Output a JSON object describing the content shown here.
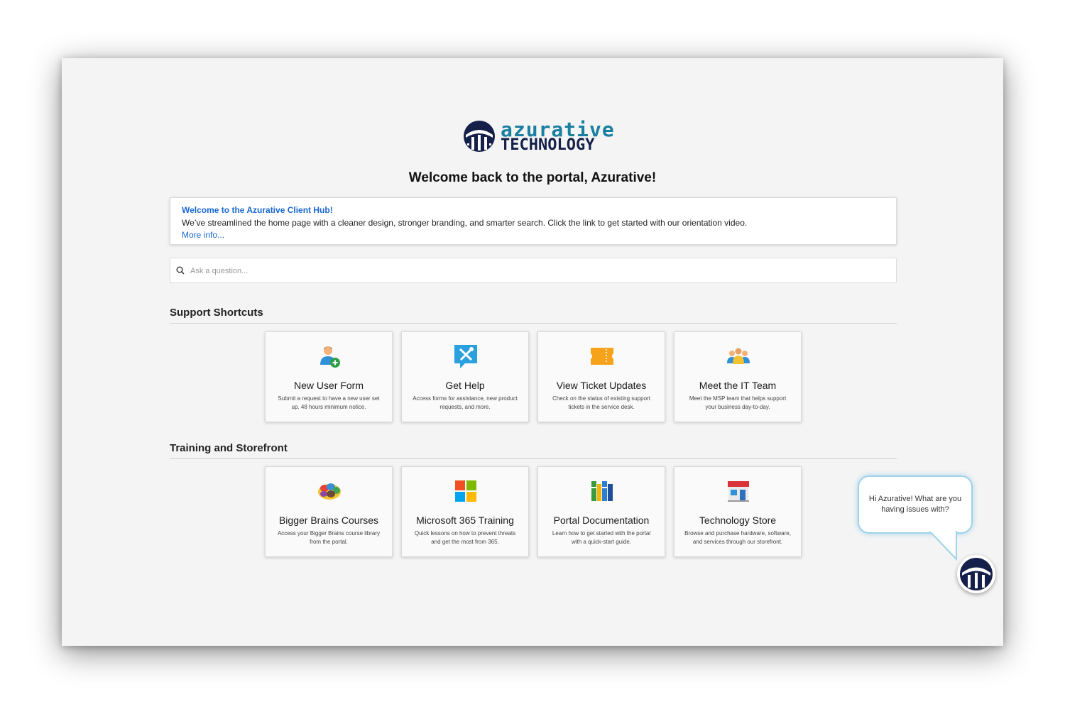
{
  "brand": {
    "line1": "azurative",
    "line2": "TECHNOLOGY"
  },
  "welcome_title": "Welcome back to the portal, Azurative!",
  "banner": {
    "title": "Welcome to the Azurative Client Hub!",
    "body": "We’ve streamlined the home page with a cleaner design, stronger branding, and smarter search. Click the link to get started with our orientation video.",
    "link": "More info..."
  },
  "search": {
    "placeholder": "Ask a question..."
  },
  "sections": [
    {
      "title": "Support Shortcuts",
      "tiles": [
        {
          "icon": "add-user-icon",
          "title": "New User Form",
          "desc": "Submit a request to have a new user set up. 48 hours minimum notice."
        },
        {
          "icon": "help-tools-icon",
          "title": "Get Help",
          "desc": "Access forms for assistance, new product requests, and more."
        },
        {
          "icon": "ticket-icon",
          "title": "View Ticket Updates",
          "desc": "Check on the status of existing support tickets in the service desk."
        },
        {
          "icon": "team-icon",
          "title": "Meet the IT Team",
          "desc": "Meet the MSP team that helps support your business day-to-day."
        }
      ]
    },
    {
      "title": "Training and Storefront",
      "tiles": [
        {
          "icon": "brain-icon",
          "title": "Bigger Brains Courses",
          "desc": "Access your Bigger Brains course library from the portal."
        },
        {
          "icon": "microsoft-logo-icon",
          "title": "Microsoft 365 Training",
          "desc": "Quick lessons on how to prevent threats and get the most from 365."
        },
        {
          "icon": "books-icon",
          "title": "Portal Documentation",
          "desc": "Learn how to get started with the portal with a quick-start guide."
        },
        {
          "icon": "store-icon",
          "title": "Technology Store",
          "desc": "Browse and purchase hardware, software, and services through our storefront."
        }
      ]
    }
  ],
  "chat": {
    "message": "Hi Azurative! What are you having issues with?"
  },
  "colors": {
    "brand_teal": "#1a7fa0",
    "brand_navy": "#14204a",
    "link_blue": "#1967d2"
  }
}
